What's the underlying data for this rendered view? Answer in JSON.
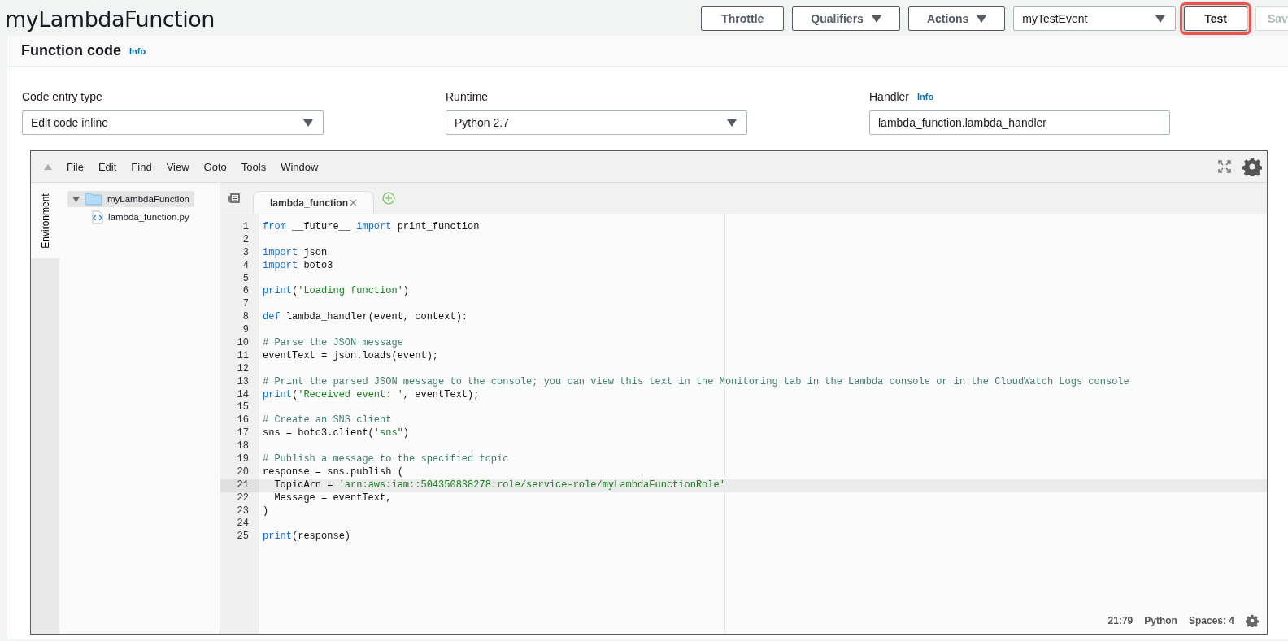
{
  "page_title": "myLambdaFunction",
  "header_buttons": [
    {
      "label": "Throttle",
      "kind": "button"
    },
    {
      "label": "Qualifiers",
      "kind": "menu"
    },
    {
      "label": "Actions",
      "kind": "menu"
    }
  ],
  "test_event": {
    "value": "myTestEvent"
  },
  "test_button": {
    "label": "Test",
    "highlighted": true
  },
  "save_button": {
    "label": "Sav",
    "disabled": true
  },
  "section": {
    "title": "Function code",
    "info": "Info"
  },
  "fields": [
    {
      "label": "Code entry type",
      "kind": "select",
      "value": "Edit code inline"
    },
    {
      "label": "Runtime",
      "kind": "select",
      "value": "Python 2.7"
    },
    {
      "label": "Handler",
      "info": "Info",
      "kind": "input",
      "value": "lambda_function.lambda_handler"
    }
  ],
  "editor": {
    "menu": [
      "File",
      "Edit",
      "Find",
      "View",
      "Goto",
      "Tools",
      "Window"
    ],
    "side_tab": "Environment",
    "tree": [
      {
        "label": "myLambdaFunction",
        "kind": "folder",
        "expanded": true,
        "selected": true,
        "children": [
          {
            "label": "lambda_function.py",
            "kind": "file",
            "selected": false
          }
        ]
      }
    ],
    "tabs": [
      {
        "label": "lambda_function",
        "selected": true
      }
    ],
    "lines": [
      {
        "number": "1",
        "current": false,
        "tokens": [
          {
            "kind": "keyword",
            "text": "from"
          },
          {
            "kind": "text",
            "text": " __future__ "
          },
          {
            "kind": "keyword",
            "text": "import"
          },
          {
            "kind": "text",
            "text": " print_function"
          }
        ]
      },
      {
        "number": "2",
        "current": false
      },
      {
        "number": "3",
        "current": false,
        "tokens": [
          {
            "kind": "keyword",
            "text": "import"
          },
          {
            "kind": "text",
            "text": " json"
          }
        ]
      },
      {
        "number": "4",
        "current": false,
        "tokens": [
          {
            "kind": "keyword",
            "text": "import"
          },
          {
            "kind": "text",
            "text": " boto3"
          }
        ]
      },
      {
        "number": "5",
        "current": false
      },
      {
        "number": "6",
        "current": false,
        "tokens": [
          {
            "kind": "keyword",
            "text": "print"
          },
          {
            "kind": "text",
            "text": "("
          },
          {
            "kind": "string",
            "text": "'Loading function'"
          },
          {
            "kind": "text",
            "text": ")"
          }
        ]
      },
      {
        "number": "7",
        "current": false
      },
      {
        "number": "8",
        "current": false,
        "tokens": [
          {
            "kind": "keyword",
            "text": "def"
          },
          {
            "kind": "text",
            "text": " lambda_handler(event, context):"
          }
        ]
      },
      {
        "number": "9",
        "current": false
      },
      {
        "number": "10",
        "current": false,
        "tokens": [
          {
            "kind": "comment",
            "text": "# Parse the JSON message"
          }
        ]
      },
      {
        "number": "11",
        "current": false,
        "tokens": [
          {
            "kind": "text",
            "text": "eventText = json.loads(event);"
          }
        ]
      },
      {
        "number": "12",
        "current": false
      },
      {
        "number": "13",
        "current": false,
        "tokens": [
          {
            "kind": "comment",
            "text": "# Print the parsed JSON message to the console; you can view this text in the Monitoring tab in the Lambda console or in the CloudWatch Logs console"
          }
        ]
      },
      {
        "number": "14",
        "current": false,
        "tokens": [
          {
            "kind": "keyword",
            "text": "print"
          },
          {
            "kind": "text",
            "text": "("
          },
          {
            "kind": "string",
            "text": "'Received event: '"
          },
          {
            "kind": "text",
            "text": ", eventText);"
          }
        ]
      },
      {
        "number": "15",
        "current": false
      },
      {
        "number": "16",
        "current": false,
        "tokens": [
          {
            "kind": "comment",
            "text": "# Create an SNS client"
          }
        ]
      },
      {
        "number": "17",
        "current": false,
        "tokens": [
          {
            "kind": "text",
            "text": "sns = boto3.client("
          },
          {
            "kind": "string",
            "text": "'sns\""
          },
          {
            "kind": "text",
            "text": ")"
          }
        ]
      },
      {
        "number": "18",
        "current": false
      },
      {
        "number": "19",
        "current": false,
        "tokens": [
          {
            "kind": "comment",
            "text": "# Publish a message to the specified topic"
          }
        ]
      },
      {
        "number": "20",
        "current": false,
        "tokens": [
          {
            "kind": "text",
            "text": "response = sns.publish ("
          }
        ]
      },
      {
        "number": "21",
        "current": true,
        "tokens": [
          {
            "kind": "text",
            "text": "  TopicArn = "
          },
          {
            "kind": "string",
            "text": "'arn:aws:iam::504350838278:role/service-role/myLambdaFunctionRole'"
          }
        ]
      },
      {
        "number": "22",
        "current": false,
        "tokens": [
          {
            "kind": "text",
            "text": "  Message = eventText,"
          }
        ]
      },
      {
        "number": "23",
        "current": false,
        "tokens": [
          {
            "kind": "text",
            "text": ")"
          }
        ]
      },
      {
        "number": "24",
        "current": false
      },
      {
        "number": "25",
        "current": false,
        "tokens": [
          {
            "kind": "keyword",
            "text": "print"
          },
          {
            "kind": "text",
            "text": "(response)"
          }
        ]
      }
    ],
    "status": {
      "position": "21:79",
      "language": "Python",
      "indent": "Spaces: 4"
    }
  }
}
